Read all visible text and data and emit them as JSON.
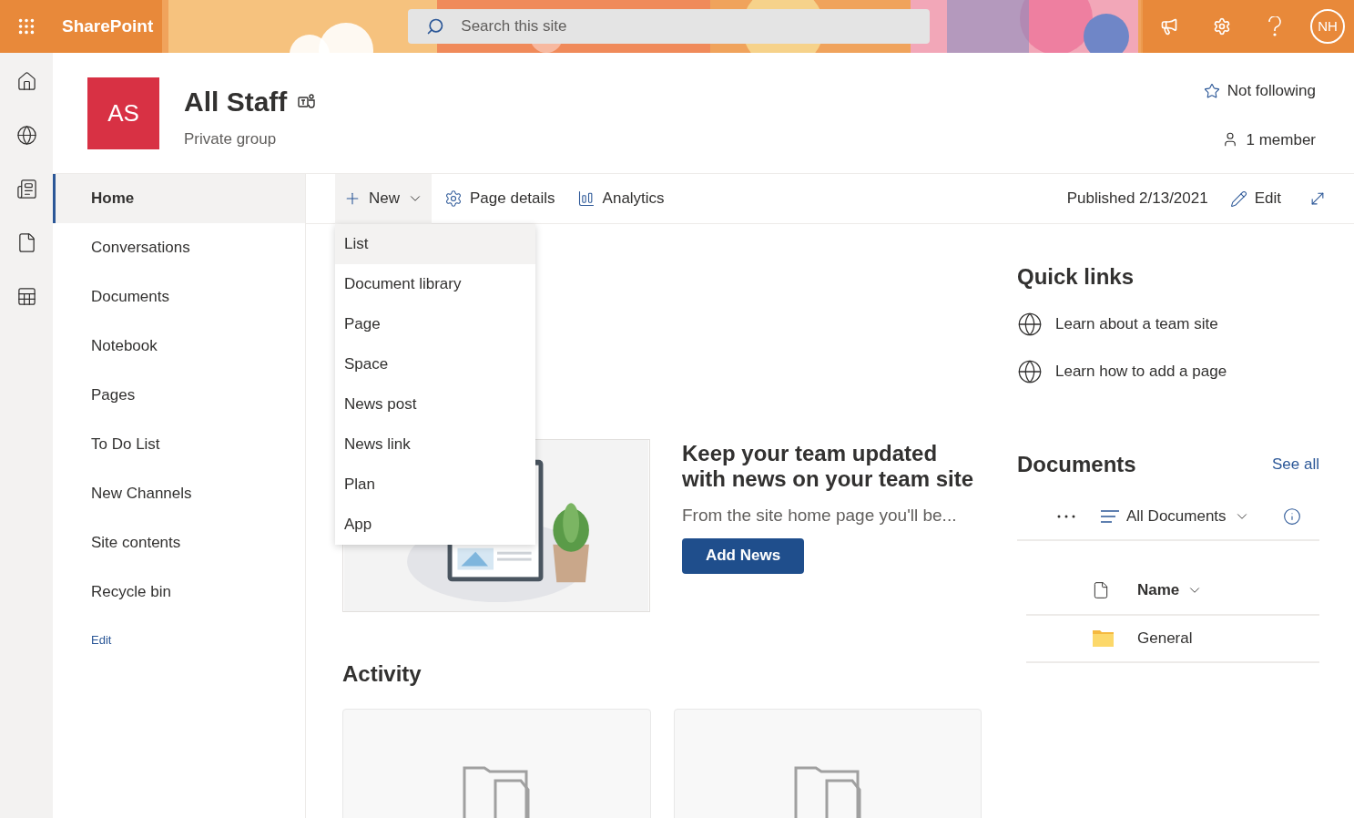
{
  "top_bar": {
    "app_name": "SharePoint",
    "search": {
      "placeholder": "Search this site"
    },
    "avatar": "NH"
  },
  "site": {
    "logo": "AS",
    "title": "All Staff",
    "subtitle": "Private group",
    "follow": "Not following",
    "members": "1 member"
  },
  "nav": {
    "items": [
      {
        "label": "Home",
        "selected": true
      },
      {
        "label": "Conversations",
        "selected": false
      },
      {
        "label": "Documents",
        "selected": false
      },
      {
        "label": "Notebook",
        "selected": false
      },
      {
        "label": "Pages",
        "selected": false
      },
      {
        "label": "To Do List",
        "selected": false
      },
      {
        "label": "New Channels",
        "selected": false
      },
      {
        "label": "Site contents",
        "selected": false
      },
      {
        "label": "Recycle bin",
        "selected": false
      }
    ],
    "edit": "Edit"
  },
  "command_bar": {
    "new": "New",
    "new_expanded": true,
    "page_details": "Page details",
    "analytics": "Analytics",
    "published": "Published 2/13/2021",
    "edit": "Edit"
  },
  "new_menu": [
    {
      "label": "List",
      "selected": true
    },
    {
      "label": "Document library",
      "selected": false
    },
    {
      "label": "Page",
      "selected": false
    },
    {
      "label": "Space",
      "selected": false
    },
    {
      "label": "News post",
      "selected": false
    },
    {
      "label": "News link",
      "selected": false
    },
    {
      "label": "Plan",
      "selected": false
    },
    {
      "label": "App",
      "selected": false
    }
  ],
  "news": {
    "kind": "picture",
    "heading": "Keep your team updated with news on your team site",
    "body": "From the site home page you'll be...",
    "button": "Add News"
  },
  "quick_links": {
    "title": "Quick links",
    "items": [
      "Learn about a team site",
      "Learn how to add a page"
    ]
  },
  "documents": {
    "title": "Documents",
    "see_all": "See all",
    "view": "All Documents",
    "column": "Name",
    "rows": [
      "General"
    ]
  },
  "activity": {
    "title": "Activity",
    "cards": [
      {
        "kind": "placeholder"
      },
      {
        "kind": "placeholder"
      }
    ]
  }
}
